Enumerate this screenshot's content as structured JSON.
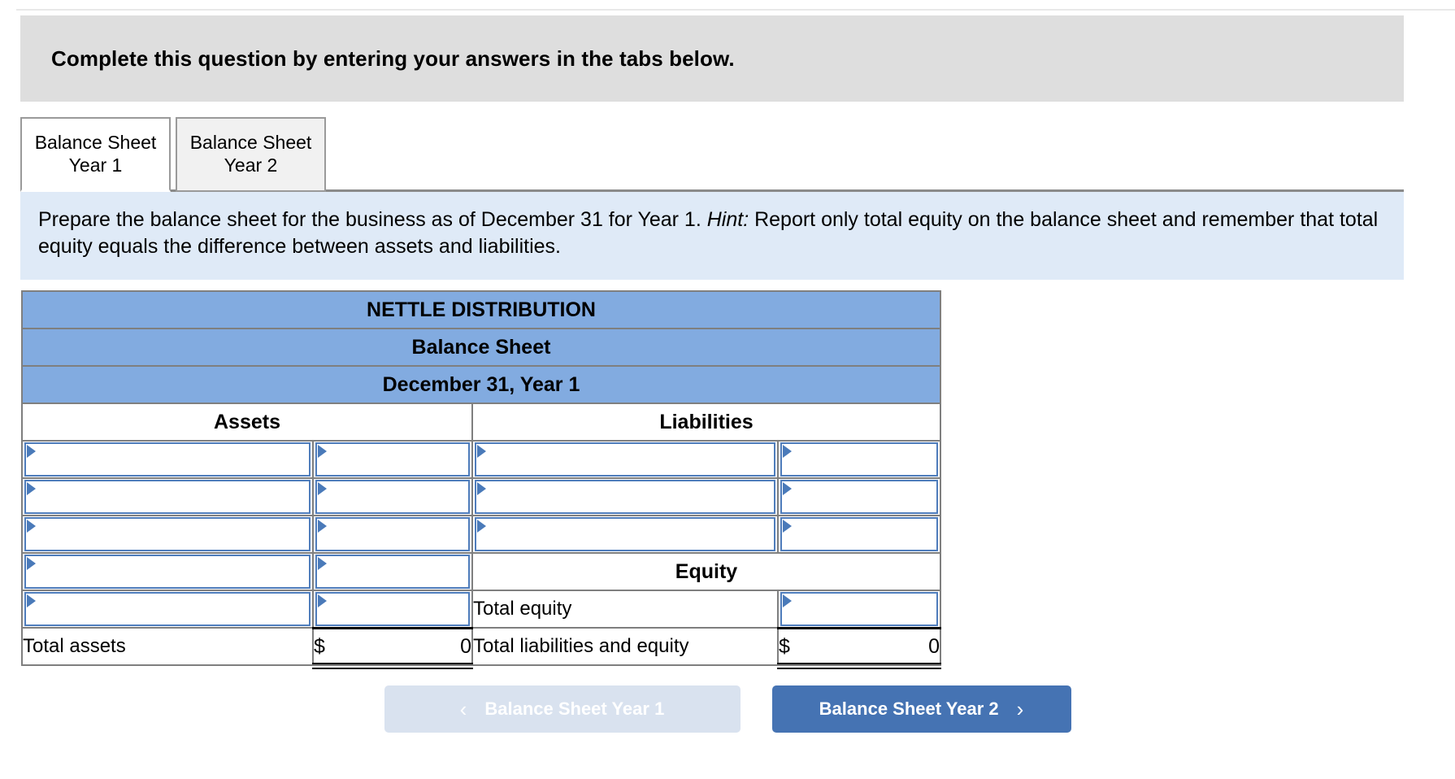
{
  "banner": {
    "text": "Complete this question by entering your answers in the tabs below."
  },
  "tabs": [
    {
      "line1": "Balance Sheet",
      "line2": "Year 1",
      "active": true
    },
    {
      "line1": "Balance Sheet",
      "line2": "Year 2",
      "active": false
    }
  ],
  "prompt": {
    "part1": "Prepare the balance sheet for the business as of December 31 for Year 1. ",
    "hint_label": "Hint:",
    "part2": " Report only total equity on the balance sheet and remember that total equity equals the difference between assets and liabilities."
  },
  "worksheet": {
    "company": "NETTLE DISTRIBUTION",
    "statement": "Balance Sheet",
    "date": "December 31, Year 1",
    "assets_header": "Assets",
    "liabilities_header": "Liabilities",
    "equity_header": "Equity",
    "total_equity_label": "Total equity",
    "total_assets_label": "Total assets",
    "total_liab_equity_label": "Total liabilities and equity",
    "currency_symbol": "$",
    "total_assets_value": "0",
    "total_liab_equity_value": "0"
  },
  "nav": {
    "prev_label": "Balance Sheet Year 1",
    "prev_chevron": "‹",
    "next_label": "Balance Sheet Year 2",
    "next_chevron": "›"
  },
  "colors": {
    "header_blue": "#82abe0",
    "prompt_blue": "#dfeaf7",
    "banner_grey": "#dedede",
    "input_border": "#4f7dbc",
    "btn_next": "#4573b3",
    "btn_prev": "#d9e2ef"
  }
}
